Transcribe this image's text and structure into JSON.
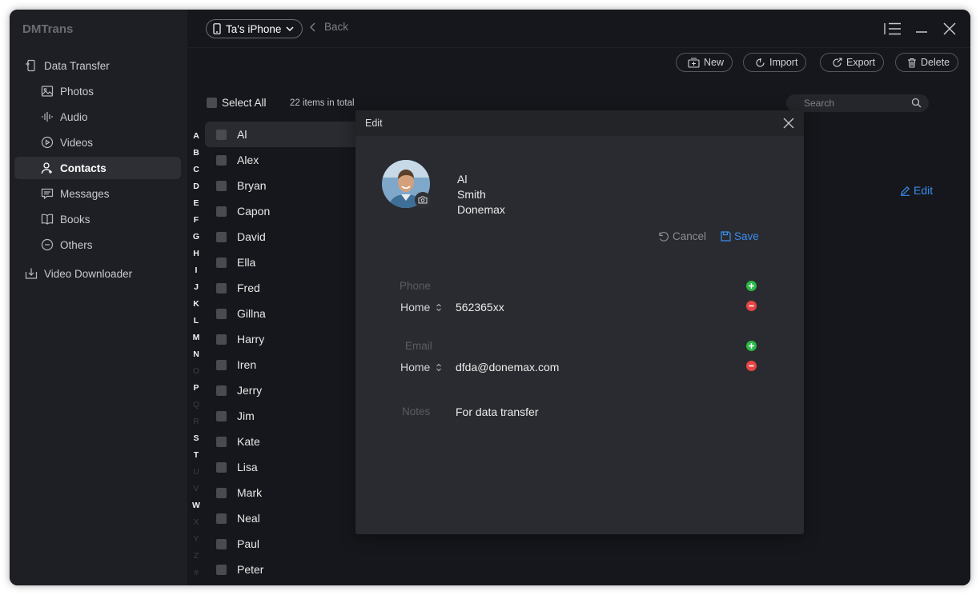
{
  "app": {
    "title": "DMTrans"
  },
  "sidebar": {
    "items": [
      {
        "label": "Data Transfer",
        "icon": "phone-transfer-icon"
      },
      {
        "label": "Photos",
        "icon": "photo-icon"
      },
      {
        "label": "Audio",
        "icon": "audio-wave-icon"
      },
      {
        "label": "Videos",
        "icon": "play-circle-icon"
      },
      {
        "label": "Contacts",
        "icon": "contact-user-icon",
        "active": true
      },
      {
        "label": "Messages",
        "icon": "message-icon"
      },
      {
        "label": "Books",
        "icon": "book-icon"
      },
      {
        "label": "Others",
        "icon": "more-circle-icon"
      },
      {
        "label": "Video Downloader",
        "icon": "download-icon"
      }
    ]
  },
  "topbar": {
    "device": "Ta's iPhone",
    "back": "Back"
  },
  "toolbar": {
    "new": "New",
    "import": "Import",
    "export": "Export",
    "delete": "Delete"
  },
  "list": {
    "select_all": "Select All",
    "total": "22 items in total",
    "search_placeholder": "Search",
    "alphabet": [
      {
        "l": "A",
        "on": true
      },
      {
        "l": "B",
        "on": true
      },
      {
        "l": "C",
        "on": true
      },
      {
        "l": "D",
        "on": true
      },
      {
        "l": "E",
        "on": true
      },
      {
        "l": "F",
        "on": true
      },
      {
        "l": "G",
        "on": true
      },
      {
        "l": "H",
        "on": true
      },
      {
        "l": "I",
        "on": true
      },
      {
        "l": "J",
        "on": true
      },
      {
        "l": "K",
        "on": true
      },
      {
        "l": "L",
        "on": true
      },
      {
        "l": "M",
        "on": true
      },
      {
        "l": "N",
        "on": true
      },
      {
        "l": "O",
        "on": false
      },
      {
        "l": "P",
        "on": true
      },
      {
        "l": "Q",
        "on": false
      },
      {
        "l": "R",
        "on": false
      },
      {
        "l": "S",
        "on": true
      },
      {
        "l": "T",
        "on": true
      },
      {
        "l": "U",
        "on": false
      },
      {
        "l": "V",
        "on": false
      },
      {
        "l": "W",
        "on": true
      },
      {
        "l": "X",
        "on": false
      },
      {
        "l": "Y",
        "on": false
      },
      {
        "l": "Z",
        "on": false
      },
      {
        "l": "#",
        "on": false
      }
    ],
    "contacts": [
      "Al",
      "Alex",
      "Bryan",
      "Capon",
      "David",
      "Ella",
      "Fred",
      "Gillna",
      "Harry",
      "Iren",
      "Jerry",
      "Jim",
      "Kate",
      "Lisa",
      "Mark",
      "Neal",
      "Paul",
      "Peter"
    ],
    "edit_link": "Edit"
  },
  "modal": {
    "title": "Edit",
    "first_name": "Al",
    "last_name": "Smith",
    "company": "Donemax",
    "cancel": "Cancel",
    "save": "Save",
    "phone_label": "Phone",
    "phone_type": "Home",
    "phone_value": "562365xx",
    "email_label": "Email",
    "email_type": "Home",
    "email_value": "dfda@donemax.com",
    "notes_label": "Notes",
    "notes_value": "For data transfer"
  },
  "colors": {
    "accent": "#3a8df0",
    "add": "#29b846",
    "remove": "#e54545",
    "background": "#16171c"
  }
}
